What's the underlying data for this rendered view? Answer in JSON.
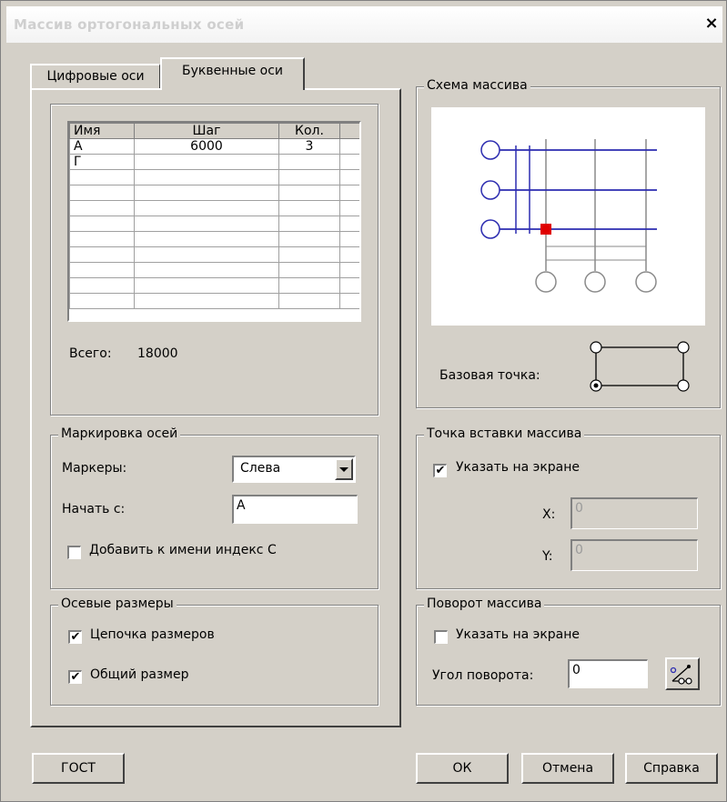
{
  "window": {
    "title": "Массив ортогональных осей",
    "close_glyph": "×"
  },
  "tabs": [
    {
      "label": "Цифровые оси",
      "active": false
    },
    {
      "label": "Буквенные оси",
      "active": true
    }
  ],
  "axes_table": {
    "headers": [
      "Имя",
      "Шаг",
      "Кол."
    ],
    "rows": [
      [
        "А",
        "6000",
        "3"
      ],
      [
        "Г",
        "",
        ""
      ]
    ],
    "total_label": "Всего:",
    "total_value": "18000"
  },
  "marking": {
    "legend": "Маркировка осей",
    "markers_label": "Маркеры:",
    "markers_value": "Слева",
    "start_label": "Начать с:",
    "start_value": "А",
    "add_index_label": "Добавить к имени индекс С",
    "add_index_checked": false
  },
  "dimensions": {
    "legend": "Осевые размеры",
    "chain_label": "Цепочка размеров",
    "chain_checked": true,
    "total_label": "Общий размер",
    "total_checked": true
  },
  "scheme": {
    "legend": "Схема массива",
    "base_point_label": "Базовая точка:"
  },
  "insert_point": {
    "legend": "Точка вставки массива",
    "on_screen_label": "Указать на экране",
    "on_screen_checked": true,
    "x_label": "X:",
    "x_value": "0",
    "y_label": "Y:",
    "y_value": "0"
  },
  "rotation": {
    "legend": "Поворот массива",
    "on_screen_label": "Указать на экране",
    "on_screen_checked": false,
    "angle_label": "Угол поворота:",
    "angle_value": "0"
  },
  "buttons": {
    "gost": "ГОСТ",
    "ok": "ОК",
    "cancel": "Отмена",
    "help": "Справка"
  },
  "colors": {
    "axis_blue": "#2c2cb0",
    "base_marker": "#e00000",
    "dim_gray": "#8a8a8a"
  },
  "check_glyph": "✔",
  "icons": {
    "pick_angle": "pick-angle-icon",
    "dropdown": "dropdown-arrow-icon"
  }
}
